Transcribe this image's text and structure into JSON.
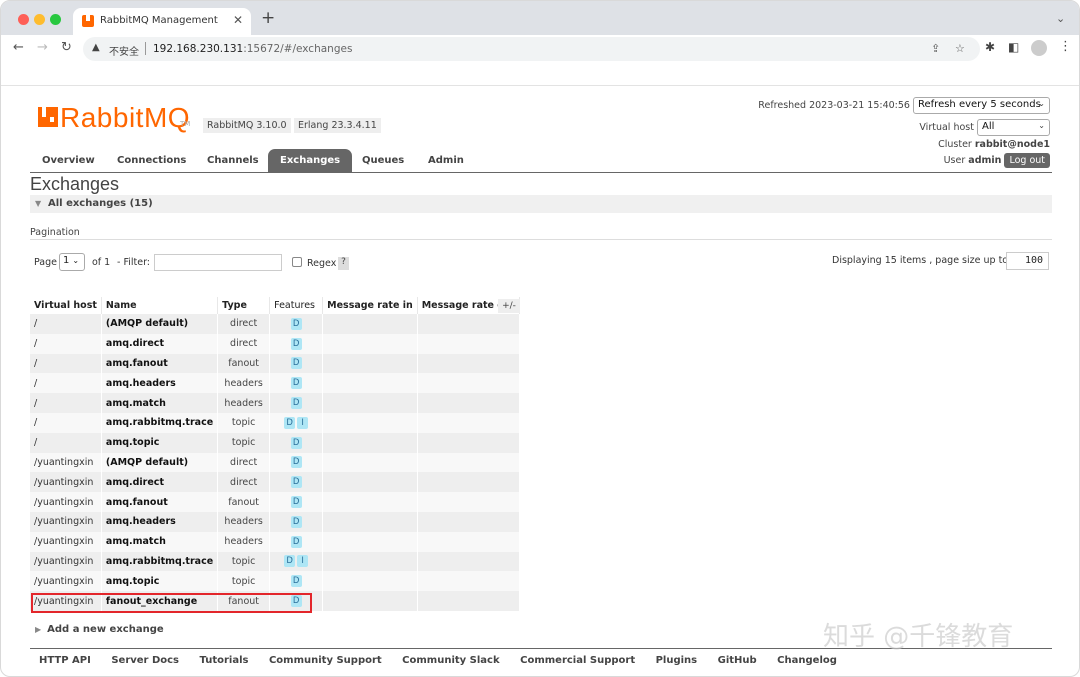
{
  "browser": {
    "tab_title": "RabbitMQ Management",
    "tab_close": "✕",
    "new_tab": "+",
    "insecure_label": "不安全",
    "url_host": "192.168.230.131",
    "url_path": ":15672/#/exchanges"
  },
  "app": {
    "logo_text": "RabbitMQ",
    "logo_tm": "TM",
    "version": "RabbitMQ 3.10.0",
    "erlang": "Erlang 23.3.4.11"
  },
  "header": {
    "refreshed": "Refreshed 2023-03-21 15:40:56",
    "refresh_option": "Refresh every 5 seconds",
    "vhost_label": "Virtual host",
    "vhost_value": "All",
    "cluster_label": "Cluster",
    "cluster_value": "rabbit@node1",
    "user_label": "User",
    "user_value": "admin",
    "logout": "Log out"
  },
  "nav": [
    "Overview",
    "Connections",
    "Channels",
    "Exchanges",
    "Queues",
    "Admin"
  ],
  "page": {
    "title": "Exchanges",
    "section": "All exchanges (15)"
  },
  "pagination": {
    "label": "Pagination",
    "page_label": "Page",
    "page_value": "1",
    "of_label": "of 1",
    "filter_label": "- Filter:",
    "regex_label": "Regex",
    "help": "?",
    "displaying": "Displaying 15 items , page size up to:",
    "page_size": "100"
  },
  "table": {
    "columns": [
      "Virtual host",
      "Name",
      "Type",
      "Features",
      "Message rate in",
      "Message rate out"
    ],
    "plus_minus": "+/-",
    "rows": [
      {
        "vhost": "/",
        "name": "(AMQP default)",
        "type": "direct",
        "features": [
          "D"
        ]
      },
      {
        "vhost": "/",
        "name": "amq.direct",
        "type": "direct",
        "features": [
          "D"
        ]
      },
      {
        "vhost": "/",
        "name": "amq.fanout",
        "type": "fanout",
        "features": [
          "D"
        ]
      },
      {
        "vhost": "/",
        "name": "amq.headers",
        "type": "headers",
        "features": [
          "D"
        ]
      },
      {
        "vhost": "/",
        "name": "amq.match",
        "type": "headers",
        "features": [
          "D"
        ]
      },
      {
        "vhost": "/",
        "name": "amq.rabbitmq.trace",
        "type": "topic",
        "features": [
          "D",
          "I"
        ]
      },
      {
        "vhost": "/",
        "name": "amq.topic",
        "type": "topic",
        "features": [
          "D"
        ]
      },
      {
        "vhost": "/yuantingxin",
        "name": "(AMQP default)",
        "type": "direct",
        "features": [
          "D"
        ]
      },
      {
        "vhost": "/yuantingxin",
        "name": "amq.direct",
        "type": "direct",
        "features": [
          "D"
        ]
      },
      {
        "vhost": "/yuantingxin",
        "name": "amq.fanout",
        "type": "fanout",
        "features": [
          "D"
        ]
      },
      {
        "vhost": "/yuantingxin",
        "name": "amq.headers",
        "type": "headers",
        "features": [
          "D"
        ]
      },
      {
        "vhost": "/yuantingxin",
        "name": "amq.match",
        "type": "headers",
        "features": [
          "D"
        ]
      },
      {
        "vhost": "/yuantingxin",
        "name": "amq.rabbitmq.trace",
        "type": "topic",
        "features": [
          "D",
          "I"
        ]
      },
      {
        "vhost": "/yuantingxin",
        "name": "amq.topic",
        "type": "topic",
        "features": [
          "D"
        ]
      },
      {
        "vhost": "/yuantingxin",
        "name": "fanout_exchange",
        "type": "fanout",
        "features": [
          "D"
        ]
      }
    ]
  },
  "add_exchange": "Add a new exchange",
  "footer": [
    "HTTP API",
    "Server Docs",
    "Tutorials",
    "Community Support",
    "Community Slack",
    "Commercial Support",
    "Plugins",
    "GitHub",
    "Changelog"
  ],
  "watermark": "知乎 @千锋教育",
  "colors": {
    "brand": "#ff6600",
    "nav_active": "#666666",
    "highlight": "#e3262b",
    "feature_badge": "#aee6f5"
  }
}
